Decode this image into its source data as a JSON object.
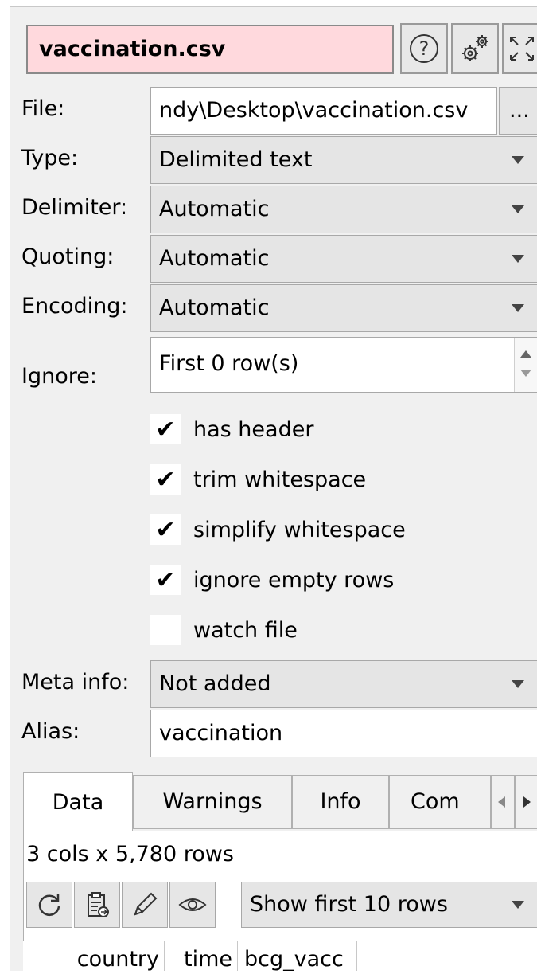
{
  "header": {
    "title": "vaccination.csv"
  },
  "form": {
    "file": {
      "label": "File:",
      "value": "ndy\\Desktop\\vaccination.csv",
      "browse": "..."
    },
    "type": {
      "label": "Type:",
      "value": "Delimited text"
    },
    "delimiter": {
      "label": "Delimiter:",
      "value": "Automatic"
    },
    "quoting": {
      "label": "Quoting:",
      "value": "Automatic"
    },
    "encoding": {
      "label": "Encoding:",
      "value": "Automatic"
    },
    "ignore": {
      "label": "Ignore:",
      "value": "First 0 row(s)"
    },
    "checks": [
      {
        "label": "has header",
        "checked": true
      },
      {
        "label": "trim whitespace",
        "checked": true
      },
      {
        "label": "simplify whitespace",
        "checked": true
      },
      {
        "label": "ignore empty rows",
        "checked": true
      },
      {
        "label": "watch file",
        "checked": false
      }
    ],
    "check_mark": "✔",
    "meta": {
      "label": "Meta info:",
      "value": "Not added"
    },
    "alias": {
      "label": "Alias:",
      "value": "vaccination"
    }
  },
  "tabs": [
    {
      "label": "Data",
      "active": true
    },
    {
      "label": "Warnings",
      "active": false
    },
    {
      "label": "Info",
      "active": false
    },
    {
      "label": "Com",
      "active": false
    }
  ],
  "summary": "3 cols x 5,780 rows",
  "toolbar": {
    "show_rows": "Show first 10 rows"
  },
  "table": {
    "columns": [
      "country",
      "time",
      "bcg_vacc"
    ]
  }
}
